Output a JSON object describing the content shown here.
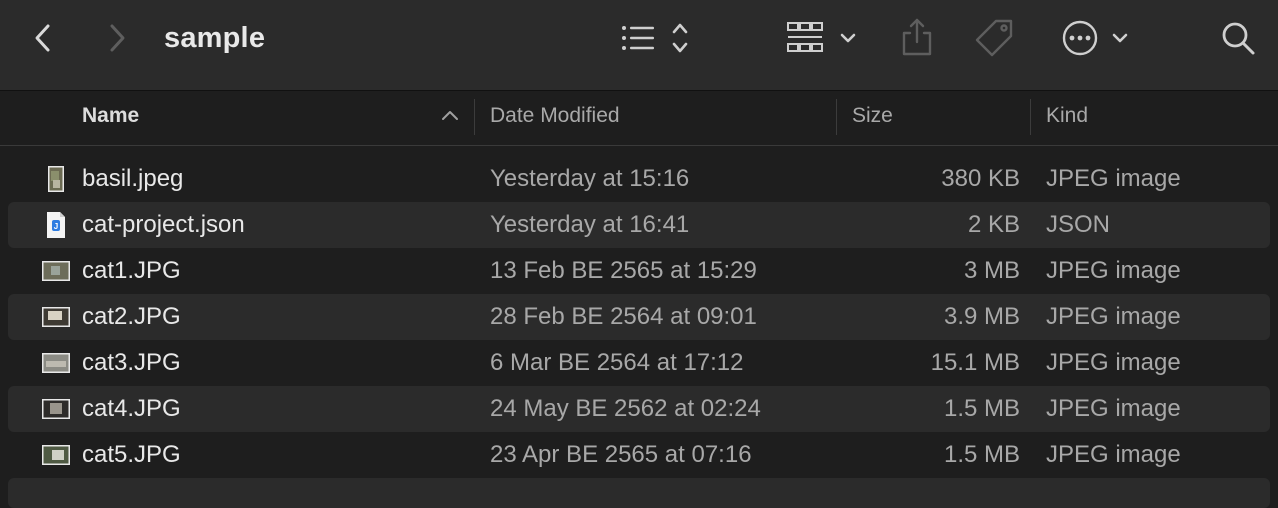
{
  "window": {
    "title": "sample"
  },
  "toolbar": {
    "back_icon": "chevron-left-icon",
    "forward_icon": "chevron-right-icon",
    "view_list_icon": "list-view-icon",
    "group_icon": "grid-group-icon",
    "share_icon": "share-icon",
    "tag_icon": "tag-icon",
    "more_icon": "ellipsis-circle-icon",
    "search_icon": "search-icon"
  },
  "columns": {
    "name": "Name",
    "date": "Date Modified",
    "size": "Size",
    "kind": "Kind",
    "sort": "ascending"
  },
  "files": [
    {
      "name": "basil.jpeg",
      "date": "Yesterday at 15:16",
      "size": "380 KB",
      "kind": "JPEG image",
      "icon": "image-thumbnail-icon"
    },
    {
      "name": "cat-project.json",
      "date": "Yesterday at 16:41",
      "size": "2 KB",
      "kind": "JSON",
      "icon": "json-file-icon"
    },
    {
      "name": "cat1.JPG",
      "date": "13 Feb BE 2565 at 15:29",
      "size": "3 MB",
      "kind": "JPEG image",
      "icon": "image-thumbnail-icon"
    },
    {
      "name": "cat2.JPG",
      "date": "28 Feb BE 2564 at 09:01",
      "size": "3.9 MB",
      "kind": "JPEG image",
      "icon": "image-thumbnail-icon"
    },
    {
      "name": "cat3.JPG",
      "date": "6 Mar BE 2564 at 17:12",
      "size": "15.1 MB",
      "kind": "JPEG image",
      "icon": "image-thumbnail-icon"
    },
    {
      "name": "cat4.JPG",
      "date": "24 May BE 2562 at 02:24",
      "size": "1.5 MB",
      "kind": "JPEG image",
      "icon": "image-thumbnail-icon"
    },
    {
      "name": "cat5.JPG",
      "date": "23 Apr BE 2565 at 07:16",
      "size": "1.5 MB",
      "kind": "JPEG image",
      "icon": "image-thumbnail-icon"
    }
  ],
  "colors": {
    "toolbar_bg": "#2b2b2b",
    "window_bg": "#1e1e1e",
    "alt_row_bg": "#2b2b2b",
    "json_icon_accent": "#2f7de1"
  }
}
